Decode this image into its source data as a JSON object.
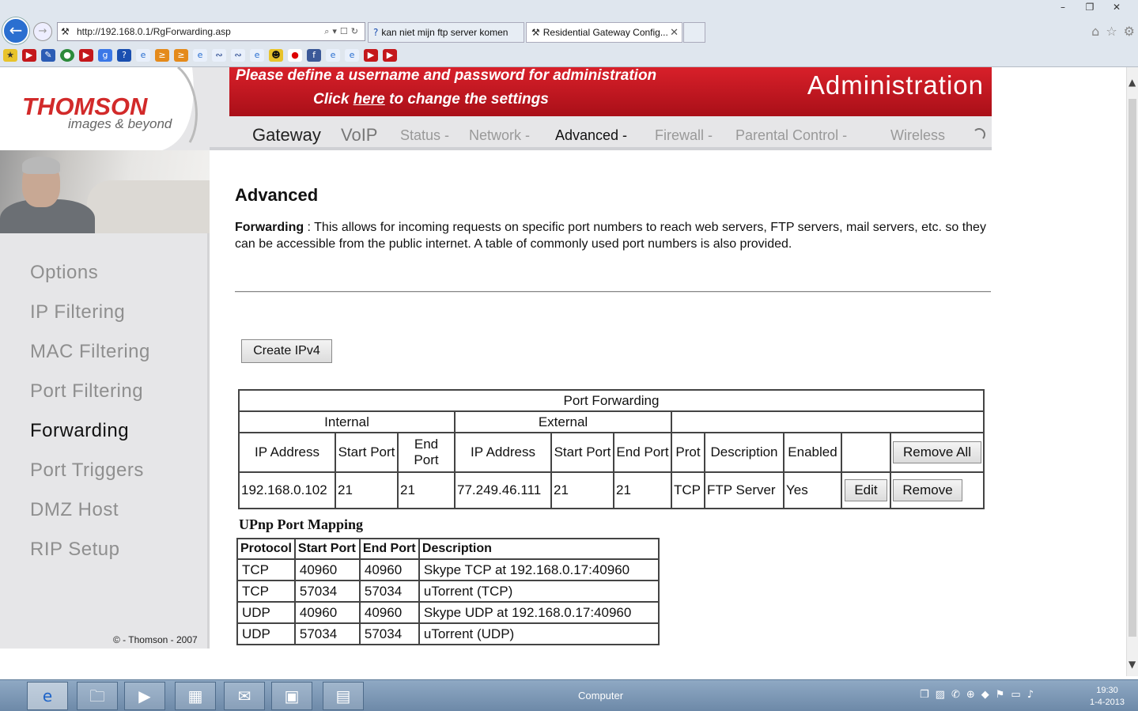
{
  "browser": {
    "url": "http://192.168.0.1/RgForwarding.asp",
    "tabs": [
      {
        "label": "kan niet mijn ftp server komen"
      },
      {
        "label": "Residential Gateway Config..."
      }
    ],
    "window_controls": [
      "–",
      "❐",
      "✕"
    ]
  },
  "banner": {
    "line1": "Please define a username and password for administration",
    "line2_prefix": "Click ",
    "line2_link": "here",
    "line2_suffix": " to change the settings",
    "title": "Administration"
  },
  "logo": {
    "brand": "THOMSON",
    "tagline": "images & beyond"
  },
  "nav": {
    "items": [
      {
        "label": "Gateway"
      },
      {
        "label": "VoIP"
      },
      {
        "label": "Status -"
      },
      {
        "label": "Network -"
      },
      {
        "label": "Advanced -"
      },
      {
        "label": "Firewall -"
      },
      {
        "label": "Parental Control -"
      },
      {
        "label": "Wireless"
      }
    ]
  },
  "sidebar": {
    "items": [
      {
        "label": "Options"
      },
      {
        "label": "IP Filtering"
      },
      {
        "label": "MAC Filtering"
      },
      {
        "label": "Port Filtering"
      },
      {
        "label": "Forwarding"
      },
      {
        "label": "Port Triggers"
      },
      {
        "label": "DMZ Host"
      },
      {
        "label": "RIP Setup"
      }
    ],
    "copyright": "© - Thomson - 2007"
  },
  "main": {
    "title": "Advanced",
    "desc_term": "Forwarding",
    "desc_text": "  :  This allows for incoming requests on specific port numbers to reach web servers, FTP servers, mail servers, etc. so they can be accessible from the public internet. A table of commonly used port numbers is also provided.",
    "create_button": "Create IPv4"
  },
  "port_forwarding": {
    "title": "Port Forwarding",
    "group_internal": "Internal",
    "group_external": "External",
    "columns": {
      "int_ip": "IP Address",
      "int_start": "Start Port",
      "int_end": "End Port",
      "ext_ip": "IP Address",
      "ext_start": "Start Port",
      "ext_end": "End Port",
      "prot": "Prot",
      "desc": "Description",
      "enabled": "Enabled"
    },
    "remove_all": "Remove All",
    "rows": [
      {
        "int_ip": "192.168.0.102",
        "int_start": "21",
        "int_end": "21",
        "ext_ip": "77.249.46.111",
        "ext_start": "21",
        "ext_end": "21",
        "prot": "TCP",
        "desc": "FTP Server",
        "enabled": "Yes",
        "edit": "Edit",
        "remove": "Remove"
      }
    ]
  },
  "upnp": {
    "title": "UPnp Port Mapping",
    "headers": [
      "Protocol",
      "Start Port",
      "End Port",
      "Description"
    ],
    "rows": [
      [
        "TCP",
        "40960",
        "40960",
        "Skype TCP at 192.168.0.17:40960"
      ],
      [
        "TCP",
        "57034",
        "57034",
        "uTorrent (TCP)"
      ],
      [
        "UDP",
        "40960",
        "40960",
        "Skype UDP at 192.168.0.17:40960"
      ],
      [
        "UDP",
        "57034",
        "57034",
        "uTorrent (UDP)"
      ]
    ]
  },
  "taskbar": {
    "label": "Computer",
    "time": "19:30",
    "date": "1-4-2013"
  }
}
